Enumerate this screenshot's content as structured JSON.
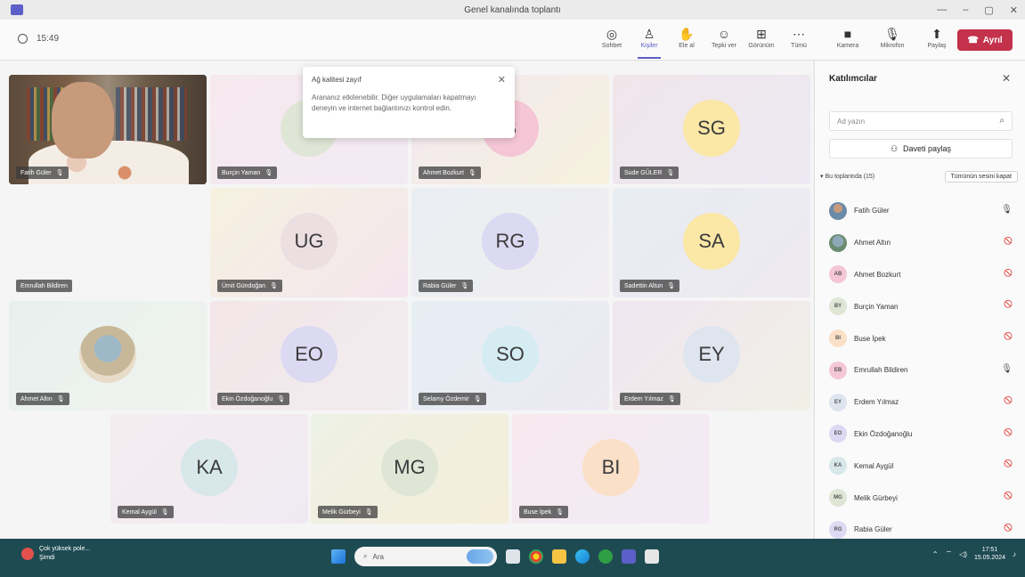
{
  "window": {
    "title": "Genel kanalında toplantı",
    "controls": [
      "—",
      "–",
      "▢",
      "✕"
    ]
  },
  "toolbar": {
    "timer": "15:49",
    "tools": [
      {
        "name": "chat",
        "icon": "◎",
        "label": "Sohbet"
      },
      {
        "name": "people",
        "icon": "♙",
        "label": "Kişiler",
        "active": true
      },
      {
        "name": "raise-hand",
        "icon": "✋",
        "label": "Ele al"
      },
      {
        "name": "react",
        "icon": "☺",
        "label": "Tepki ver"
      },
      {
        "name": "view",
        "icon": "⊞",
        "label": "Görünüm"
      },
      {
        "name": "more",
        "icon": "⋯",
        "label": "Tümü"
      }
    ],
    "media": [
      {
        "name": "camera",
        "icon": "■",
        "label": "Kamera"
      },
      {
        "name": "mic",
        "icon": "🎙",
        "label": "Mikrofon"
      },
      {
        "name": "share",
        "icon": "⬆",
        "label": "Paylaş"
      }
    ],
    "leave_label": "Ayrıl"
  },
  "popup": {
    "title": "Ağ kalitesi zayıf",
    "body": "Arananız etkilenebilir. Diğer uygulamaları kapatmayı deneyin ve internet bağlantınızı kontrol edin."
  },
  "tiles": [
    {
      "name": "Fatih Güler",
      "type": "video"
    },
    {
      "name": "Burçin Yaman",
      "initials": "B",
      "color": "#dfe6d6"
    },
    {
      "name": "Ahmet Bozkurt",
      "initials": "B",
      "color": "#f4c6d6"
    },
    {
      "name": "Sude GÜLER",
      "initials": "SG",
      "color": "#fbe7a6"
    },
    {
      "name": "Emrullah Bildiren",
      "type": "empty"
    },
    {
      "name": "Ümit Gündoğan",
      "initials": "UG",
      "color": "#ecdfe2"
    },
    {
      "name": "Rabia Güler",
      "initials": "RG",
      "color": "#dcd9f2"
    },
    {
      "name": "Sadettin Altun",
      "initials": "SA",
      "color": "#fbe7a6"
    },
    {
      "name": "Ahmet Altın",
      "type": "photo"
    },
    {
      "name": "Ekin Özdoğanoğlu",
      "initials": "EO",
      "color": "#dcd9f2"
    },
    {
      "name": "Selamy Özdemir",
      "initials": "SO",
      "color": "#d4ecf2"
    },
    {
      "name": "Erdem Yılmaz",
      "initials": "EY",
      "color": "#dfe5ef"
    },
    {
      "name": "Kemal Aygül",
      "initials": "KA",
      "color": "#d7e7ea"
    },
    {
      "name": "Melik Gürbeyi",
      "initials": "MG",
      "color": "#dfe6d6"
    },
    {
      "name": "Buse İpek",
      "initials": "BI",
      "color": "#fbe0c8"
    }
  ],
  "panel": {
    "title": "Katılımcılar",
    "search_placeholder": "Ad yazın",
    "share_label": "Daveti paylaş",
    "section_label": "Bu toplantıda (15)",
    "mute_all_label": "Tümünün sesini kapat",
    "participants": [
      {
        "initials": "",
        "name": "Fatih Güler",
        "avatar": "photo1",
        "mic": "on"
      },
      {
        "initials": "",
        "name": "Ahmet Altın",
        "avatar": "photo2",
        "mic": "off"
      },
      {
        "initials": "AB",
        "name": "Ahmet Bozkurt",
        "color": "#f4c6d6",
        "mic": "off"
      },
      {
        "initials": "BY",
        "name": "Burçin Yaman",
        "color": "#dfe6d6",
        "mic": "off"
      },
      {
        "initials": "BI",
        "name": "Buse İpek",
        "color": "#fbe0c8",
        "mic": "off"
      },
      {
        "initials": "EB",
        "name": "Emrullah Bildiren",
        "color": "#f4c6d6",
        "mic": "on"
      },
      {
        "initials": "EY",
        "name": "Erdem Yılmaz",
        "color": "#dfe5ef",
        "mic": "off"
      },
      {
        "initials": "EO",
        "name": "Ekin Özdoğanoğlu",
        "color": "#dcd9f2",
        "mic": "off"
      },
      {
        "initials": "KA",
        "name": "Kemal Aygül",
        "color": "#d7e7ea",
        "mic": "off"
      },
      {
        "initials": "MG",
        "name": "Melik Gürbeyi",
        "color": "#dfe6d6",
        "mic": "off"
      },
      {
        "initials": "RG",
        "name": "Rabia Güler",
        "color": "#dcd9f2",
        "mic": "off"
      }
    ]
  },
  "taskbar": {
    "weather_line1": "Çok yüksek pole...",
    "weather_line2": "Şimdi",
    "search_label": "Ara",
    "time": "17:51",
    "date": "15.05.2024"
  }
}
